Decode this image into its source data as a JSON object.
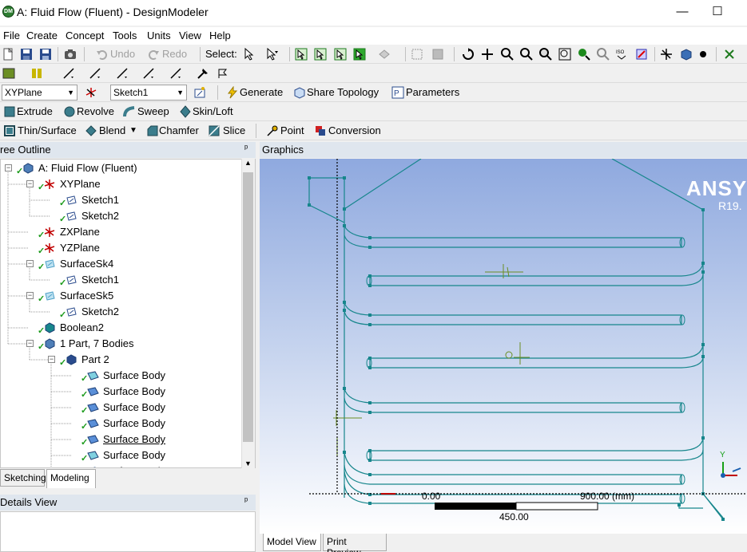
{
  "window": {
    "title": "A: Fluid Flow (Fluent) - DesignModeler",
    "app_icon": "DM",
    "minimize": "—",
    "maximize": "☐"
  },
  "menu": [
    "File",
    "Create",
    "Concept",
    "Tools",
    "Units",
    "View",
    "Help"
  ],
  "toolbar1": {
    "undo": "Undo",
    "redo": "Redo",
    "select": "Select:"
  },
  "toolbar3": {
    "plane_combo": "XYPlane",
    "sketch_combo": "Sketch1",
    "generate": "Generate",
    "share_topology": "Share Topology",
    "parameters": "Parameters"
  },
  "toolbar4": {
    "extrude": "Extrude",
    "revolve": "Revolve",
    "sweep": "Sweep",
    "skin_loft": "Skin/Loft"
  },
  "toolbar5": {
    "thin_surface": "Thin/Surface",
    "blend": "Blend",
    "chamfer": "Chamfer",
    "slice": "Slice",
    "point": "Point",
    "conversion": "Conversion"
  },
  "tree": {
    "header": "ree Outline",
    "pin": "ᵖ",
    "items": [
      {
        "label": "A: Fluid Flow (Fluent)",
        "icon": "model-icon",
        "level": 0,
        "toggle": "−"
      },
      {
        "label": "XYPlane",
        "icon": "plane-axes-icon",
        "level": 1,
        "toggle": "−"
      },
      {
        "label": "Sketch1",
        "icon": "sketch-icon",
        "level": 2,
        "toggle": ""
      },
      {
        "label": "Sketch2",
        "icon": "sketch-icon",
        "level": 2,
        "toggle": ""
      },
      {
        "label": "ZXPlane",
        "icon": "plane-axes-icon",
        "level": 1,
        "toggle": ""
      },
      {
        "label": "YZPlane",
        "icon": "plane-axes-icon",
        "level": 1,
        "toggle": ""
      },
      {
        "label": "SurfaceSk4",
        "icon": "surface-sketch-icon",
        "level": 1,
        "toggle": "−"
      },
      {
        "label": "Sketch1",
        "icon": "sketch-icon",
        "level": 2,
        "toggle": ""
      },
      {
        "label": "SurfaceSk5",
        "icon": "surface-sketch-icon",
        "level": 1,
        "toggle": "−"
      },
      {
        "label": "Sketch2",
        "icon": "sketch-icon",
        "level": 2,
        "toggle": ""
      },
      {
        "label": "Boolean2",
        "icon": "boolean-icon",
        "level": 1,
        "toggle": ""
      },
      {
        "label": "1 Part, 7 Bodies",
        "icon": "parts-icon",
        "level": 1,
        "toggle": "−"
      },
      {
        "label": "Part 2",
        "icon": "part-icon",
        "level": 2,
        "toggle": "−"
      },
      {
        "label": "Surface Body",
        "icon": "surface-body-icon",
        "level": 3,
        "toggle": ""
      },
      {
        "label": "Surface Body",
        "icon": "surface-body-icon",
        "level": 3,
        "toggle": ""
      },
      {
        "label": "Surface Body",
        "icon": "surface-body-icon",
        "level": 3,
        "toggle": ""
      },
      {
        "label": "Surface Body",
        "icon": "surface-body-icon",
        "level": 3,
        "toggle": ""
      },
      {
        "label": "Surface Body",
        "icon": "surface-body-icon",
        "level": 3,
        "toggle": ""
      },
      {
        "label": "Surface Body",
        "icon": "surface-body-icon",
        "level": 3,
        "toggle": ""
      },
      {
        "label": "Surface Body",
        "icon": "surface-body-icon",
        "level": 3,
        "toggle": ""
      }
    ],
    "tabs": [
      "Sketching",
      "Modeling"
    ],
    "active_tab": "Modeling"
  },
  "details": {
    "header": "Details View",
    "pin": "ᵖ"
  },
  "graphics": {
    "header": "Graphics",
    "brand": "ANSYS",
    "version": "R19.",
    "scale_start": "0.00",
    "scale_end": "900.00 (mm)",
    "scale_mid": "450.00",
    "axis_y": "Y",
    "tabs": [
      "Model View",
      "Print Preview"
    ],
    "active_tab": "Model View"
  },
  "colors": {
    "geometry": "#17868c",
    "header_bg": "#dfe6ee",
    "check": "#1a9a1a"
  }
}
